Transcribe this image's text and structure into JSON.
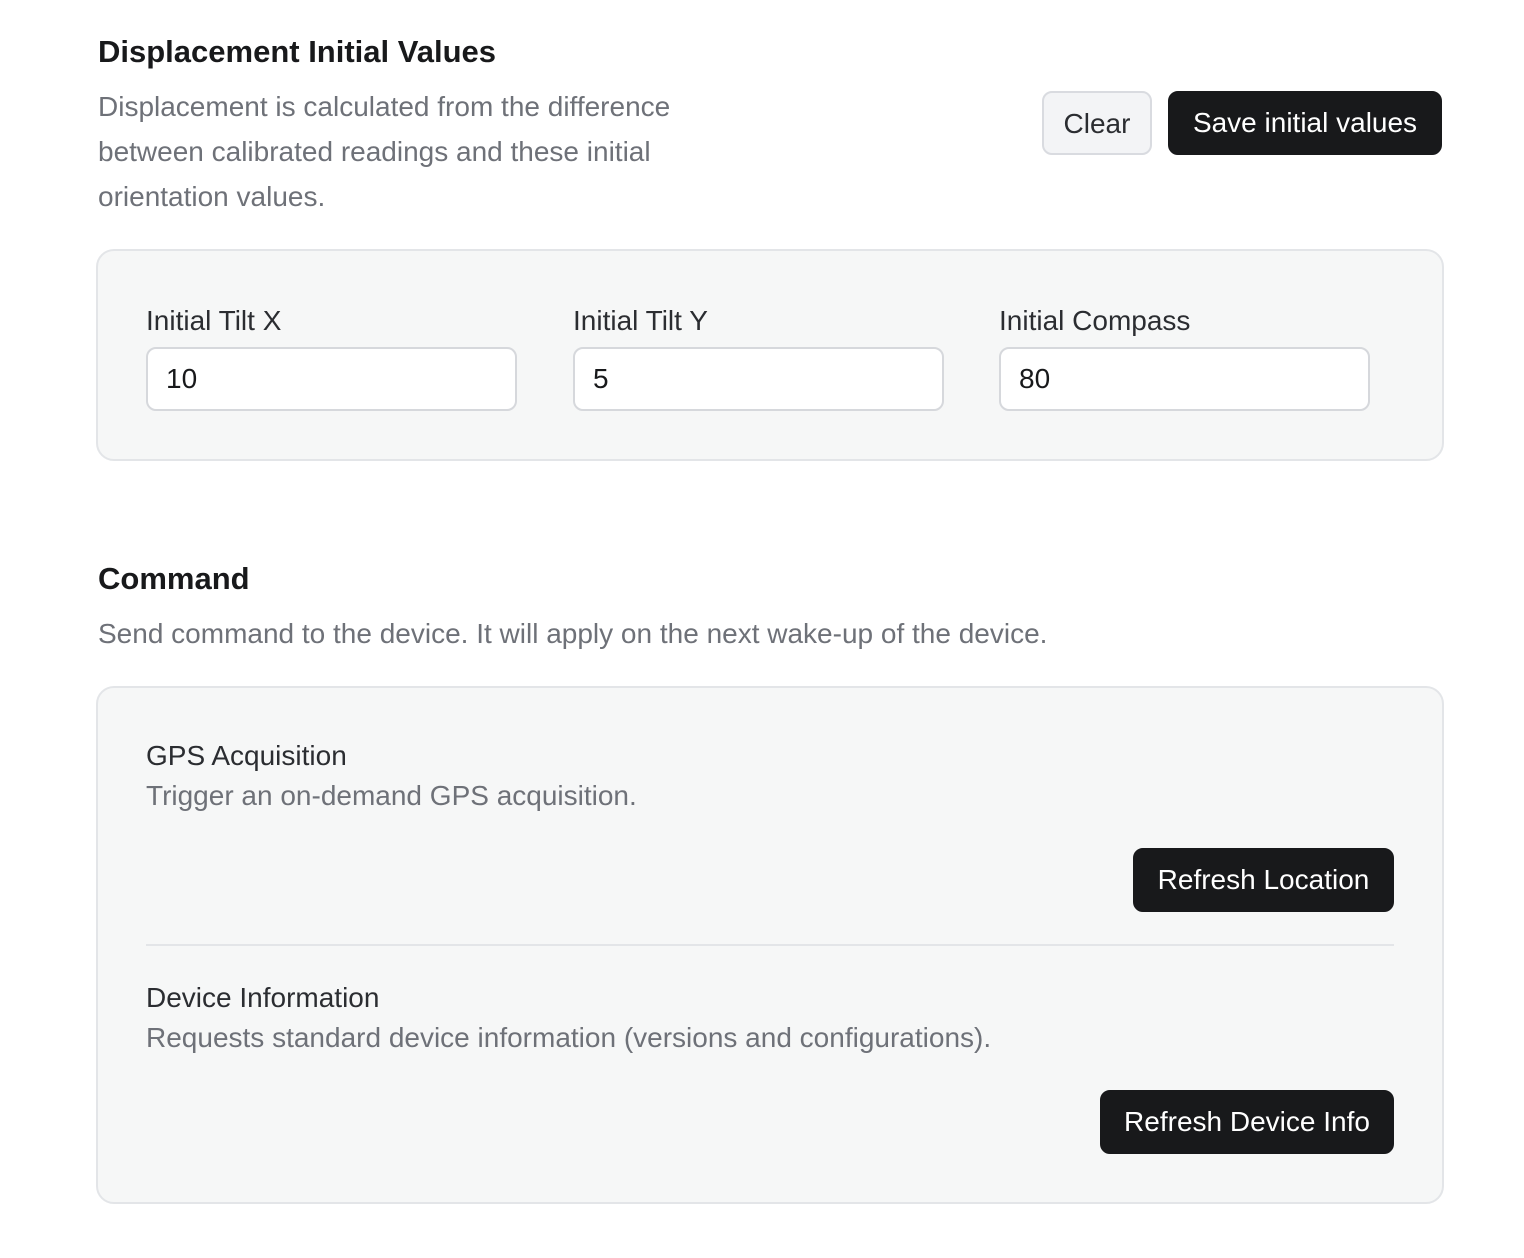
{
  "displacement": {
    "title": "Displacement Initial Values",
    "description": "Displacement is calculated from the difference between calibrated readings and these initial orientation values.",
    "clear_label": "Clear",
    "save_label": "Save initial values",
    "fields": [
      {
        "label": "Initial Tilt X",
        "value": "10"
      },
      {
        "label": "Initial Tilt Y",
        "value": "5"
      },
      {
        "label": "Initial Compass",
        "value": "80"
      }
    ]
  },
  "command": {
    "title": "Command",
    "description": "Send command to the device. It will apply on the next wake-up of the device.",
    "items": [
      {
        "title": "GPS Acquisition",
        "description": "Trigger an on-demand GPS acquisition.",
        "button_label": "Refresh Location"
      },
      {
        "title": "Device Information",
        "description": "Requests standard device information (versions and configurations).",
        "button_label": "Refresh Device Info"
      }
    ]
  },
  "colors": {
    "primary_button": "#18191b",
    "secondary_button": "#f3f4f6",
    "panel_background": "#f6f7f7",
    "muted_text": "#6e7178"
  }
}
